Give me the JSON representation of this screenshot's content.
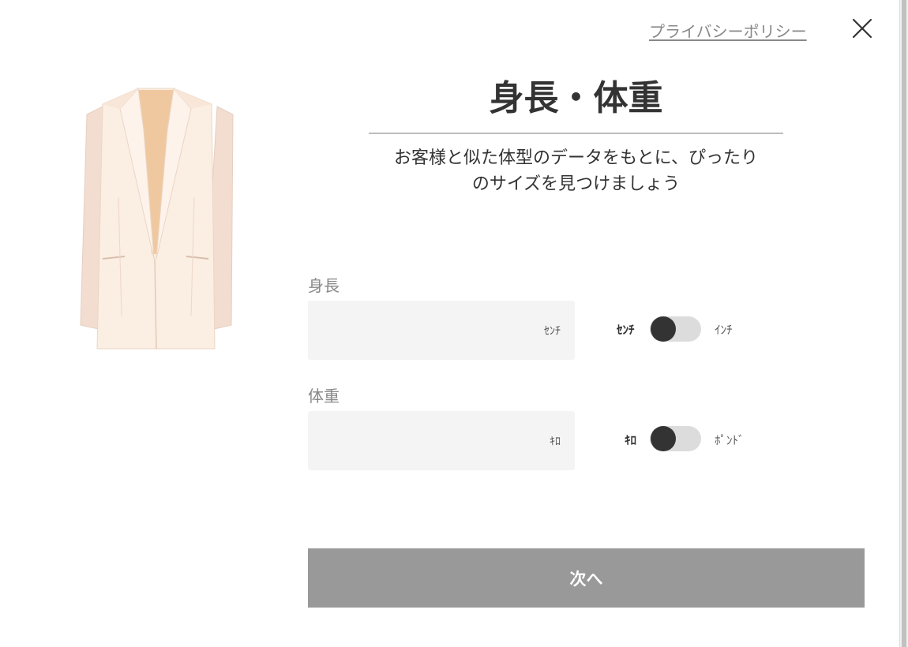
{
  "header": {
    "privacy_link": "プライバシーポリシー",
    "close_icon": "close-icon"
  },
  "product": {
    "image_icon": "jacket-image"
  },
  "title": "身長・体重",
  "subtitle_line1": "お客様と似た体型のデータをもとに、ぴったり",
  "subtitle_line2": "のサイズを見つけましょう",
  "height": {
    "label": "身長",
    "value": "",
    "unit": "ｾﾝﾁ",
    "toggle_left": "ｾﾝﾁ",
    "toggle_right": "ｲﾝﾁ",
    "toggle_selected": "ｾﾝﾁ"
  },
  "weight": {
    "label": "体重",
    "value": "",
    "unit": "ｷﾛ",
    "toggle_left": "ｷﾛ",
    "toggle_right": "ﾎﾟﾝﾄﾞ",
    "toggle_selected": "ｷﾛ"
  },
  "next_button": "次へ",
  "colors": {
    "accent_dark": "#333333",
    "button_disabled": "#999999",
    "input_bg": "#f4f4f4"
  }
}
